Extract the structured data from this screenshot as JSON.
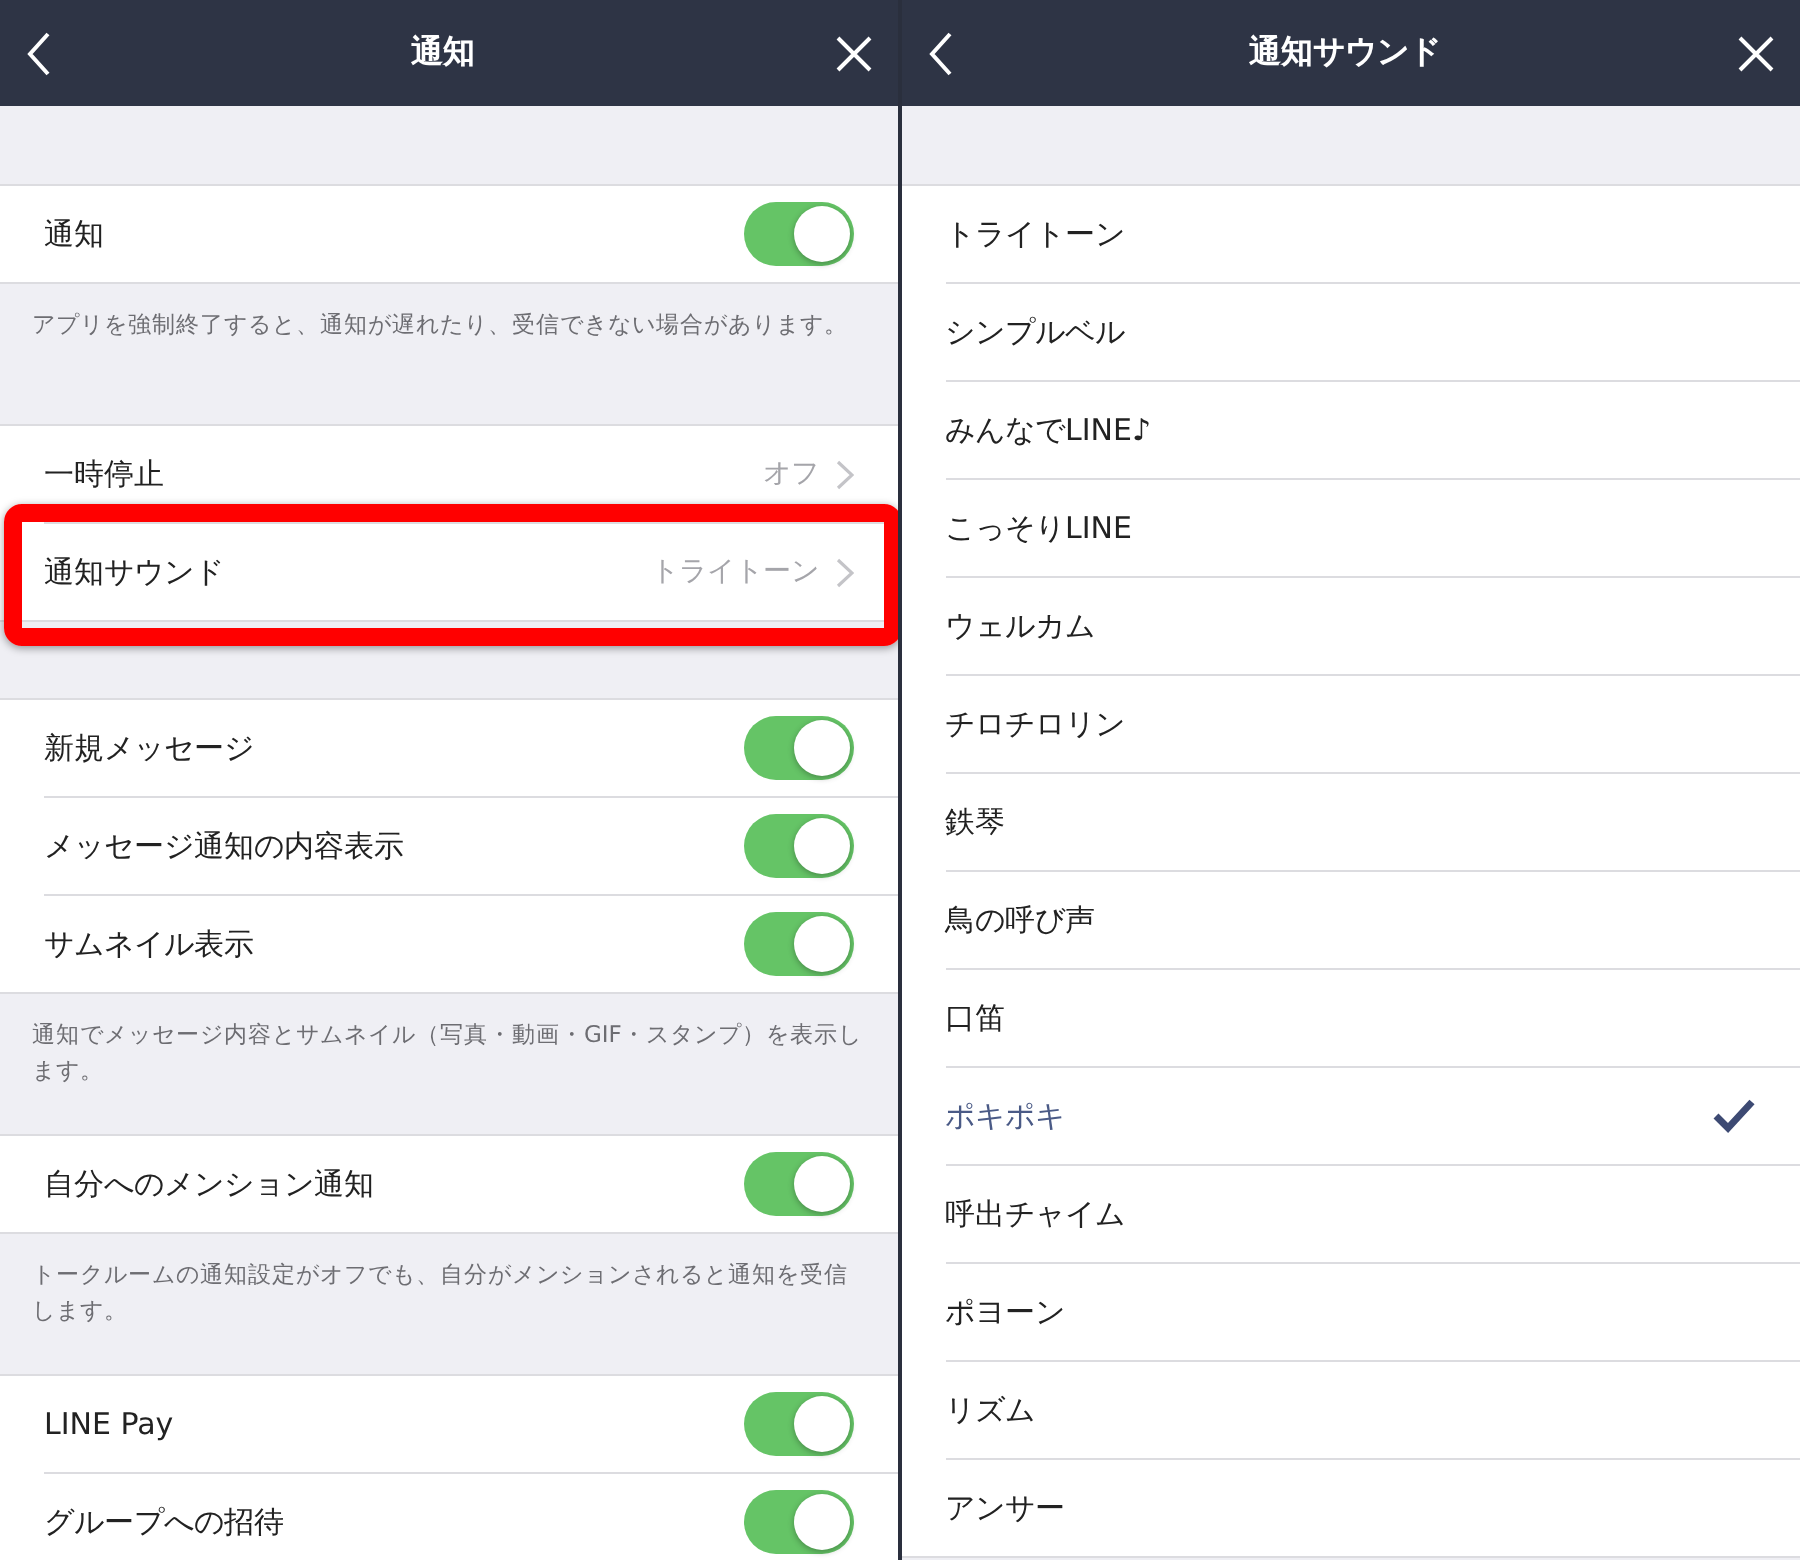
{
  "panels": [
    {
      "title": "通知",
      "sections": [
        {
          "rows": [
            {
              "kind": "toggle",
              "label": "通知",
              "on": true
            }
          ],
          "note": "アプリを強制終了すると、通知が遅れたり、受信できない場合があります。"
        },
        {
          "rows": [
            {
              "kind": "link",
              "label": "一時停止",
              "value": "オフ",
              "highlighted": false
            },
            {
              "kind": "link",
              "label": "通知サウンド",
              "value": "トライトーン",
              "highlighted": true
            }
          ]
        },
        {
          "rows": [
            {
              "kind": "toggle",
              "label": "新規メッセージ",
              "on": true
            },
            {
              "kind": "toggle",
              "label": "メッセージ通知の内容表示",
              "on": true
            },
            {
              "kind": "toggle",
              "label": "サムネイル表示",
              "on": true
            }
          ],
          "note": "通知でメッセージ内容とサムネイル（写真・動画・GIF・スタンプ）を表示します。"
        },
        {
          "rows": [
            {
              "kind": "toggle",
              "label": "自分へのメンション通知",
              "on": true
            }
          ],
          "note": "トークルームの通知設定がオフでも、自分がメンションされると通知を受信します。"
        },
        {
          "rows": [
            {
              "kind": "toggle",
              "label": "LINE Pay",
              "on": true
            },
            {
              "kind": "toggle",
              "label": "グループへの招待",
              "on": true
            }
          ]
        }
      ]
    },
    {
      "title": "通知サウンド",
      "sections": [
        {
          "rows": [
            {
              "kind": "option",
              "label": "トライトーン",
              "selected": false
            },
            {
              "kind": "option",
              "label": "シンプルベル",
              "selected": false
            },
            {
              "kind": "option",
              "label": "みんなでLINE♪",
              "selected": false
            },
            {
              "kind": "option",
              "label": "こっそりLINE",
              "selected": false
            },
            {
              "kind": "option",
              "label": "ウェルカム",
              "selected": false
            },
            {
              "kind": "option",
              "label": "チロチロリン",
              "selected": false
            },
            {
              "kind": "option",
              "label": "鉄琴",
              "selected": false
            },
            {
              "kind": "option",
              "label": "鳥の呼び声",
              "selected": false
            },
            {
              "kind": "option",
              "label": "口笛",
              "selected": false
            },
            {
              "kind": "option",
              "label": "ポキポキ",
              "selected": true
            },
            {
              "kind": "option",
              "label": "呼出チャイム",
              "selected": false
            },
            {
              "kind": "option",
              "label": "ポヨーン",
              "selected": false
            },
            {
              "kind": "option",
              "label": "リズム",
              "selected": false
            },
            {
              "kind": "option",
              "label": "アンサー",
              "selected": false
            }
          ]
        }
      ]
    }
  ]
}
